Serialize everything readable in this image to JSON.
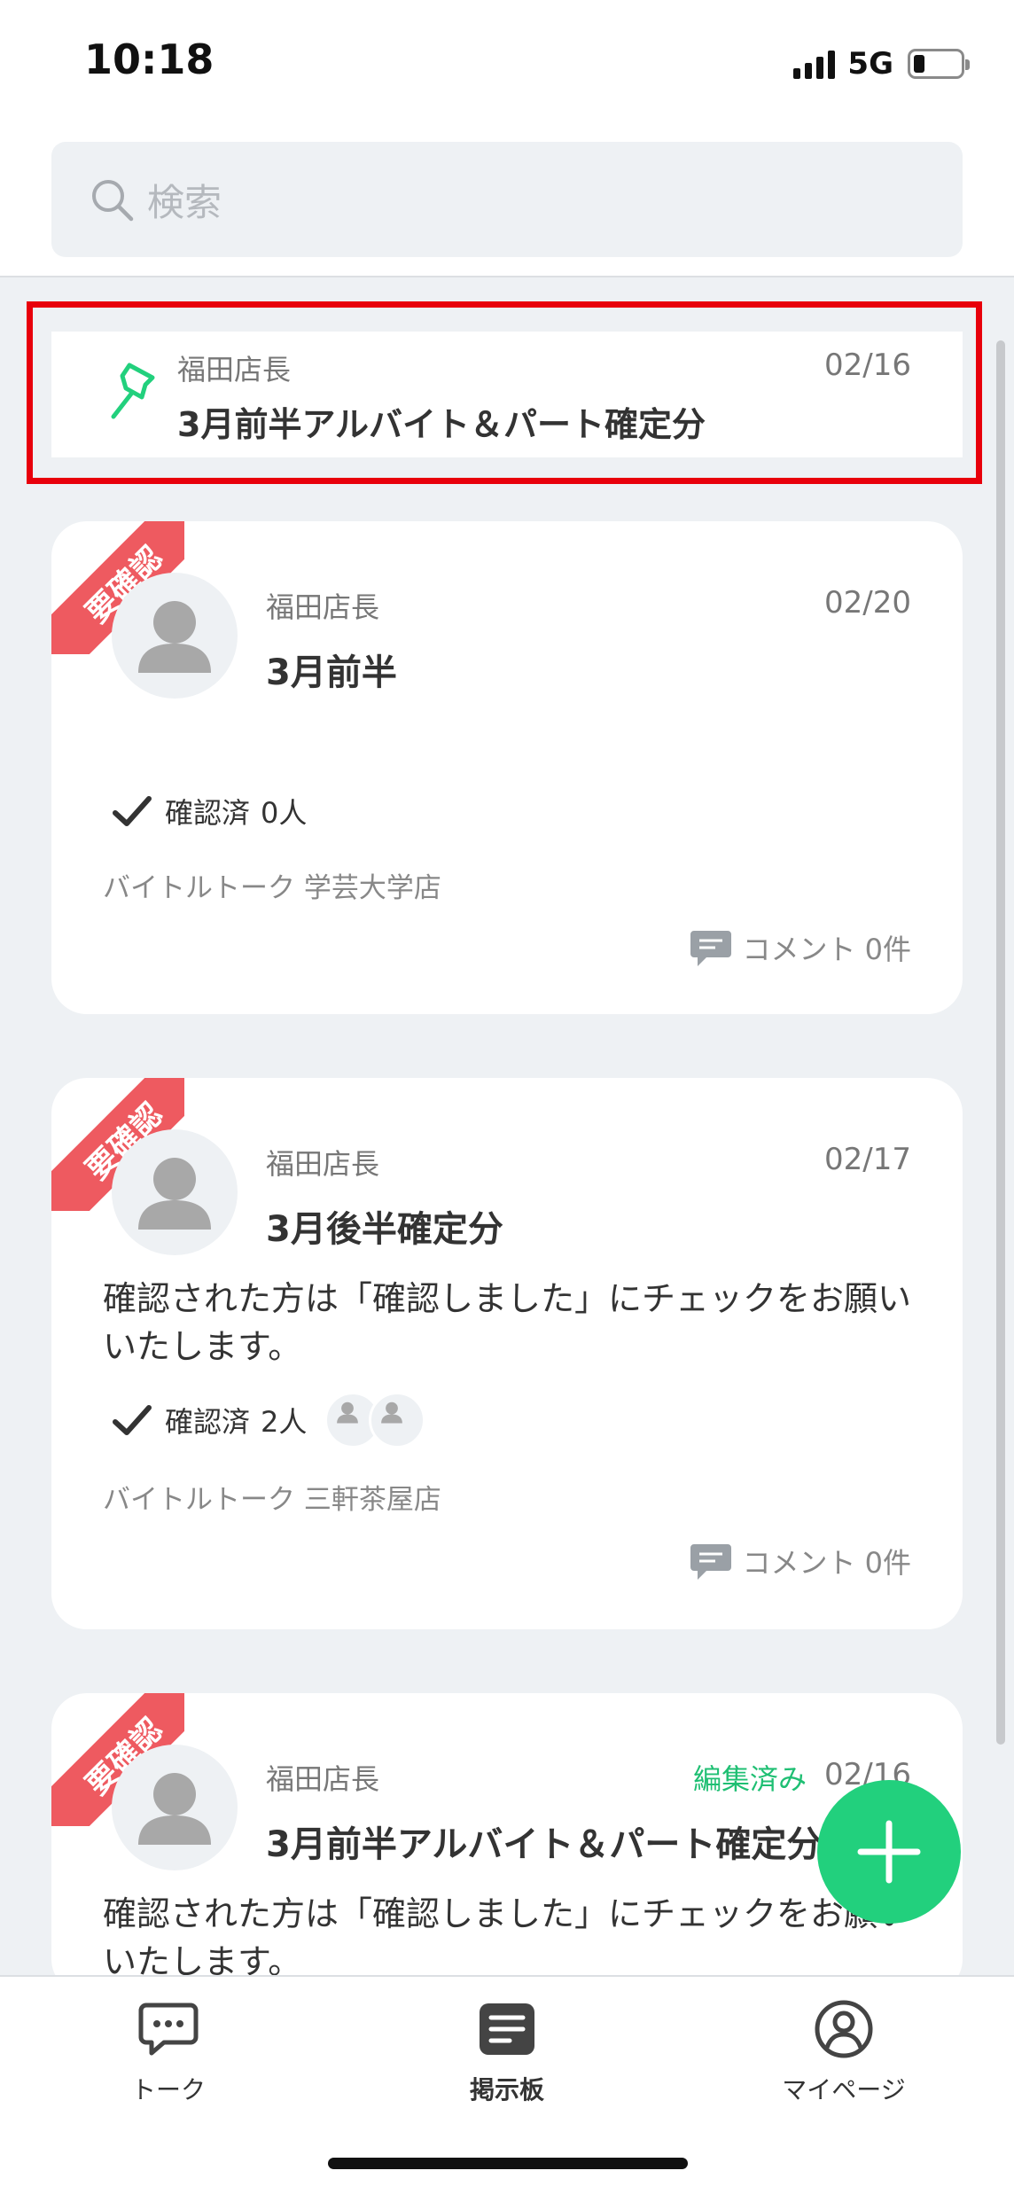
{
  "status_bar": {
    "time": "10:18",
    "network": "5G"
  },
  "search": {
    "placeholder": "検索"
  },
  "pinned_post": {
    "author": "福田店長",
    "date": "02/16",
    "title": "3月前半アルバイト＆パート確定分"
  },
  "posts": [
    {
      "badge": "要確認",
      "author": "福田店長",
      "date": "02/20",
      "title": "3月前半",
      "body": "",
      "confirm_label": "確認済",
      "confirm_count": "0人",
      "store": "バイトルトーク 学芸大学店",
      "comment": "コメント 0件"
    },
    {
      "badge": "要確認",
      "author": "福田店長",
      "date": "02/17",
      "title": "3月後半確定分",
      "body": "確認された方は「確認しました」にチェックをお願いいたします。",
      "confirm_label": "確認済",
      "confirm_count": "2人",
      "store": "バイトルトーク 三軒茶屋店",
      "comment": "コメント 0件"
    },
    {
      "badge": "要確認",
      "author": "福田店長",
      "edited": "編集済み",
      "date": "02/16",
      "title": "3月前半アルバイト＆パート確定分",
      "body": "確認された方は「確認しました」にチェックをお願いいたします。"
    }
  ],
  "bottom_nav": {
    "items": [
      {
        "label": "トーク",
        "icon": "chat-bubble-icon"
      },
      {
        "label": "掲示板",
        "icon": "board-icon"
      },
      {
        "label": "マイページ",
        "icon": "user-circle-icon"
      }
    ],
    "active": "掲示板"
  },
  "colors": {
    "accent": "#22d07d",
    "badge": "#ee5a60",
    "highlight_frame": "#e8000b",
    "edited_text": "#1fbf73"
  }
}
